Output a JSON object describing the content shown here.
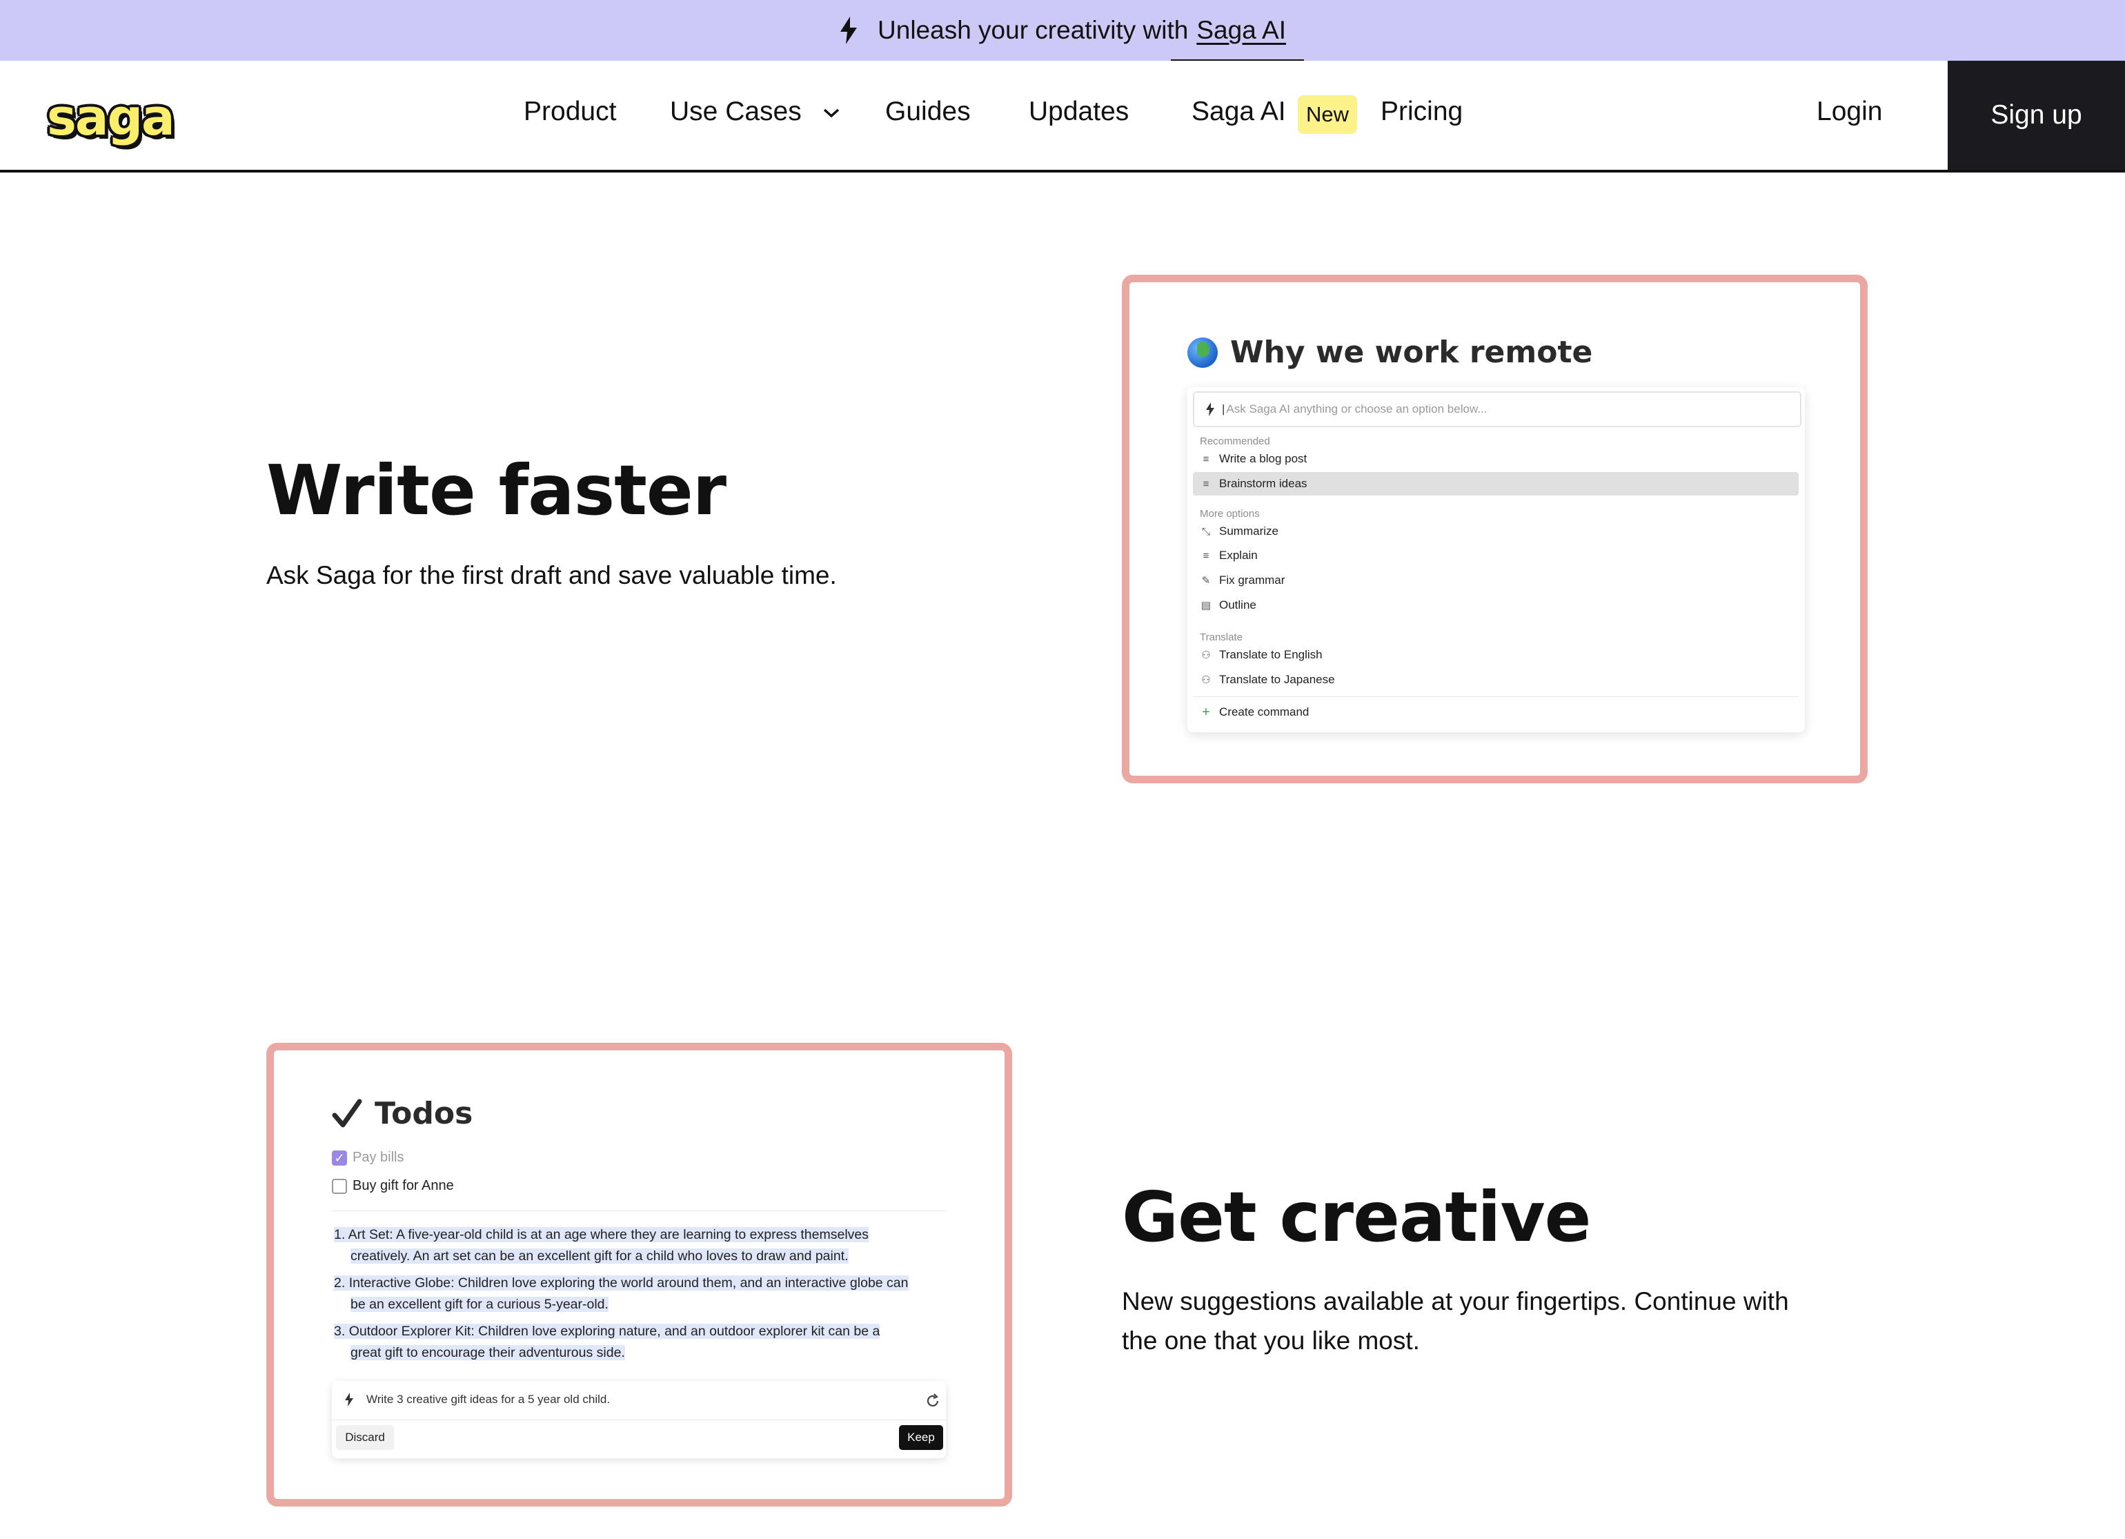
{
  "banner": {
    "prefix": "Unleash your creativity with",
    "link": "Saga AI"
  },
  "nav": {
    "logo": "saga",
    "links": {
      "product": "Product",
      "use_cases": "Use Cases",
      "guides": "Guides",
      "updates": "Updates",
      "saga_ai": "Saga AI",
      "new_badge": "New",
      "pricing": "Pricing"
    },
    "login": "Login",
    "signup": "Sign up"
  },
  "section1": {
    "heading": "Write faster",
    "subtext": "Ask Saga for the first draft and save valuable time.",
    "card": {
      "doc_title": "Why we work remote",
      "input_placeholder": "Ask Saga AI anything or choose an option below...",
      "recommended_label": "Recommended",
      "recommended": [
        "Write a blog post",
        "Brainstorm ideas"
      ],
      "more_label": "More options",
      "more": [
        "Summarize",
        "Explain",
        "Fix grammar",
        "Outline"
      ],
      "translate_label": "Translate",
      "translate": [
        "Translate to English",
        "Translate to Japanese"
      ],
      "create_command": "Create command"
    }
  },
  "section2": {
    "heading": "Get creative",
    "subtext_line1": "New suggestions available at your fingertips. Continue with",
    "subtext_line2": "the one that you like most.",
    "card": {
      "doc_title": "Todos",
      "todos": [
        {
          "label": "Pay bills",
          "checked": true
        },
        {
          "label": "Buy gift for Anne",
          "checked": false
        }
      ],
      "suggestions": [
        {
          "num": "1.",
          "line1": "Art Set: A five-year-old child is at an age where they are learning to express themselves",
          "line2": "creatively. An art set can be an excellent gift for a child who loves to draw and paint."
        },
        {
          "num": "2.",
          "line1": "Interactive Globe: Children love exploring the world around them, and an interactive globe can",
          "line2": "be an excellent gift for a curious 5-year-old."
        },
        {
          "num": "3.",
          "line1": "Outdoor Explorer Kit: Children love exploring nature, and an outdoor explorer kit can be a",
          "line2": "great gift to encourage their adventurous side."
        }
      ],
      "prompt": "Write 3 creative gift ideas for a 5 year old child.",
      "discard": "Discard",
      "keep": "Keep"
    }
  },
  "colors": {
    "banner_bg": "#cdc9f6",
    "card_border": "#eba8a2",
    "signup_bg": "#1b1b1f",
    "badge_bg": "#fbf38a",
    "logo_fill": "#fbee6b"
  }
}
